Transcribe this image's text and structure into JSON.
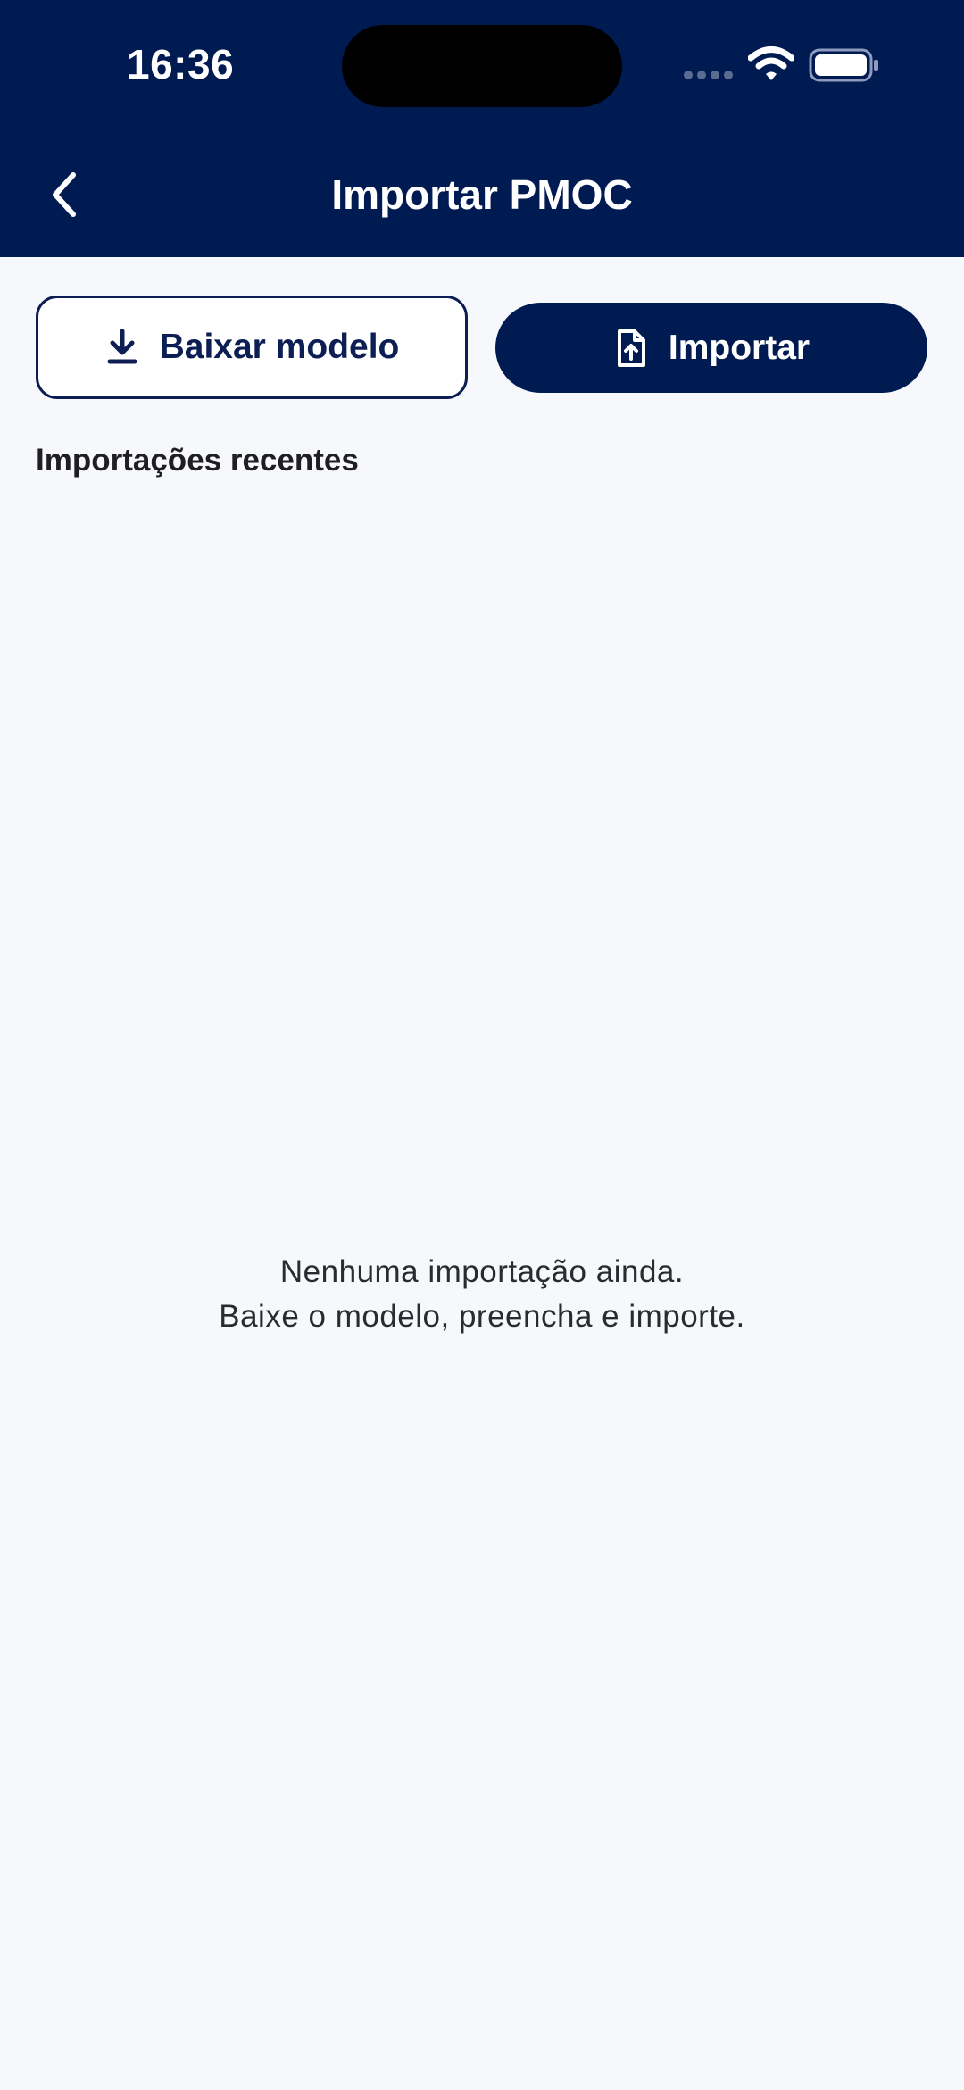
{
  "status_bar": {
    "time": "16:36",
    "icons": [
      "cellular-signal-icon",
      "wifi-icon",
      "battery-icon"
    ]
  },
  "app_bar": {
    "title": "Importar PMOC",
    "back_icon": "chevron-left-icon"
  },
  "actions": {
    "download_template": {
      "label": "Baixar modelo",
      "icon": "download-icon"
    },
    "import": {
      "label": "Importar",
      "icon": "file-upload-icon"
    }
  },
  "recent_imports": {
    "title": "Importações recentes",
    "empty_line1": "Nenhuma importação ainda.",
    "empty_line2": "Baixe o modelo, preencha e importe."
  },
  "colors": {
    "primary": "#001a52",
    "background": "#f7f8fc",
    "text": "#1e1e24"
  }
}
